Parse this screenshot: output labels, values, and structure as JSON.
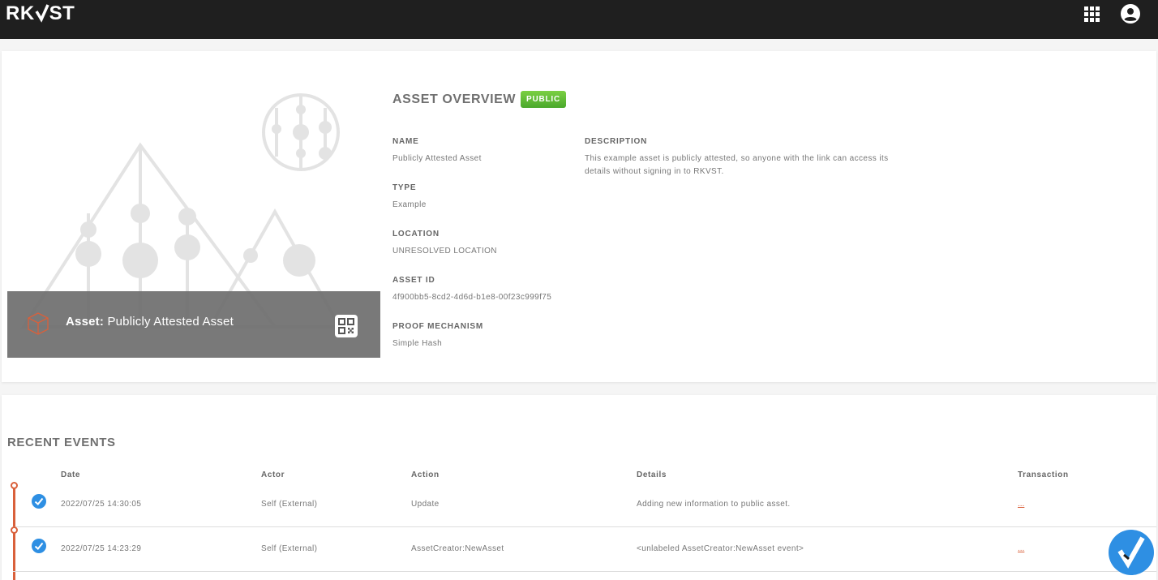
{
  "header": {
    "logo_left": "RK",
    "logo_right": "ST",
    "apps_icon": "apps-grid-icon",
    "account_icon": "account-circle-icon"
  },
  "hero": {
    "prefix": "Asset:",
    "name": "Publicly Attested Asset",
    "cube_icon": "cube-icon",
    "qr_icon": "qr-code-icon"
  },
  "overview": {
    "title": "ASSET OVERVIEW",
    "badge": "PUBLIC",
    "fields": {
      "name_label": "NAME",
      "name_value": "Publicly Attested Asset",
      "type_label": "TYPE",
      "type_value": "Example",
      "location_label": "LOCATION",
      "location_value": "UNRESOLVED LOCATION",
      "asset_id_label": "ASSET ID",
      "asset_id_value": "4f900bb5-8cd2-4d6d-b1e8-00f23c999f75",
      "proof_label": "PROOF MECHANISM",
      "proof_value": "Simple Hash",
      "description_label": "DESCRIPTION",
      "description_value": "This example asset is publicly attested, so anyone with the link can access its details without signing in to RKVST."
    }
  },
  "events": {
    "title": "RECENT EVENTS",
    "columns": {
      "date": "Date",
      "actor": "Actor",
      "action": "Action",
      "details": "Details",
      "transaction": "Transaction"
    },
    "rows": [
      {
        "date": "2022/07/25 14:30:05",
        "actor": "Self (External)",
        "action": "Update",
        "details": "Adding new information to public asset.",
        "transaction": "..."
      },
      {
        "date": "2022/07/25 14:23:29",
        "actor": "Self (External)",
        "action": "AssetCreator:NewAsset",
        "details": "<unlabeled AssetCreator:NewAsset event>",
        "transaction": "..."
      }
    ]
  },
  "colors": {
    "topbar": "#1f1f1f",
    "accent": "#d9603b",
    "badge_green": "#5cb832",
    "check_blue": "#2e8fe3"
  }
}
